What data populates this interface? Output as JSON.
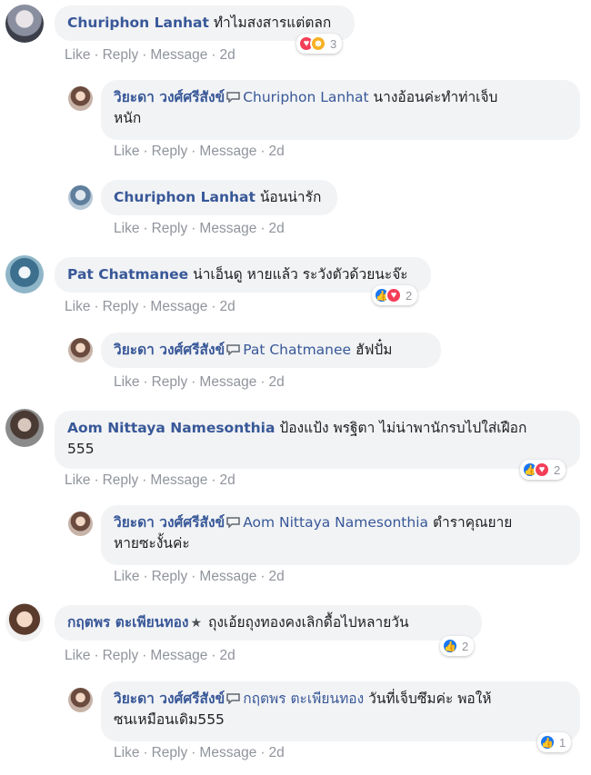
{
  "actions": {
    "like": "Like",
    "reply": "Reply",
    "message": "Message",
    "sep": "·"
  },
  "comments": [
    {
      "author": "Churiphon Lanhat",
      "text": "ทำไมสงสารแต่ตลก",
      "time": "2d",
      "reactions": {
        "icons": [
          "love-icon",
          "haha-icon"
        ],
        "count": "3"
      }
    },
    {
      "author": "วิยะดา วงศ์ศรีสังข์",
      "mention": "Churiphon Lanhat",
      "text": "นางอ้อนค่ะทำท่าเจ็บ",
      "text2": "หนัก",
      "time": "2d"
    },
    {
      "author": "Churiphon Lanhat",
      "text": "น้อนน่ารัก",
      "time": "2d"
    },
    {
      "author": "Pat Chatmanee",
      "text": "น่าเอ็นดู หายแล้ว ระวังตัวด้วยนะจ๊ะ",
      "time": "2d",
      "reactions": {
        "icons": [
          "like-icon",
          "love-icon"
        ],
        "count": "2"
      }
    },
    {
      "author": "วิยะดา วงศ์ศรีสังข์",
      "mention": "Pat Chatmanee",
      "text": "ฮัฟปั๋ม",
      "time": "2d"
    },
    {
      "author": "Aom Nittaya Namesonthia",
      "text": "ป้องแป้ง พรฐิตา ไม่น่าพานักรบไปใส่เฝือก",
      "text2": "555",
      "time": "2d",
      "reactions": {
        "icons": [
          "like-icon",
          "love-icon"
        ],
        "count": "2"
      }
    },
    {
      "author": "วิยะดา วงศ์ศรีสังข์",
      "mention": "Aom Nittaya Namesonthia",
      "text": "ตำราคุณยาย",
      "text2": "หายซะงั้นค่ะ",
      "time": "2d"
    },
    {
      "author": "กฤตพร ตะเพียนทอง",
      "text": "ถุงเอ้ยถุงทองคงเลิกดื้อไปหลายวัน",
      "time": "2d",
      "reactions": {
        "icons": [
          "like-icon"
        ],
        "count": "2"
      }
    },
    {
      "author": "วิยะดา วงศ์ศรีสังข์",
      "mention": "กฤตพร ตะเพียนทอง",
      "text": "วันที่เจ็บซึมค่ะ พอให้",
      "text2": "ซนเหมือนเดิม555",
      "time": "2d",
      "reactions": {
        "icons": [
          "like-icon"
        ],
        "count": "1"
      }
    }
  ],
  "colors": {
    "name": "#385898",
    "bubble": "#f2f3f5",
    "meta": "#90949c",
    "like": "#1877f2",
    "love": "#f33e58",
    "haha": "#f7b125"
  }
}
